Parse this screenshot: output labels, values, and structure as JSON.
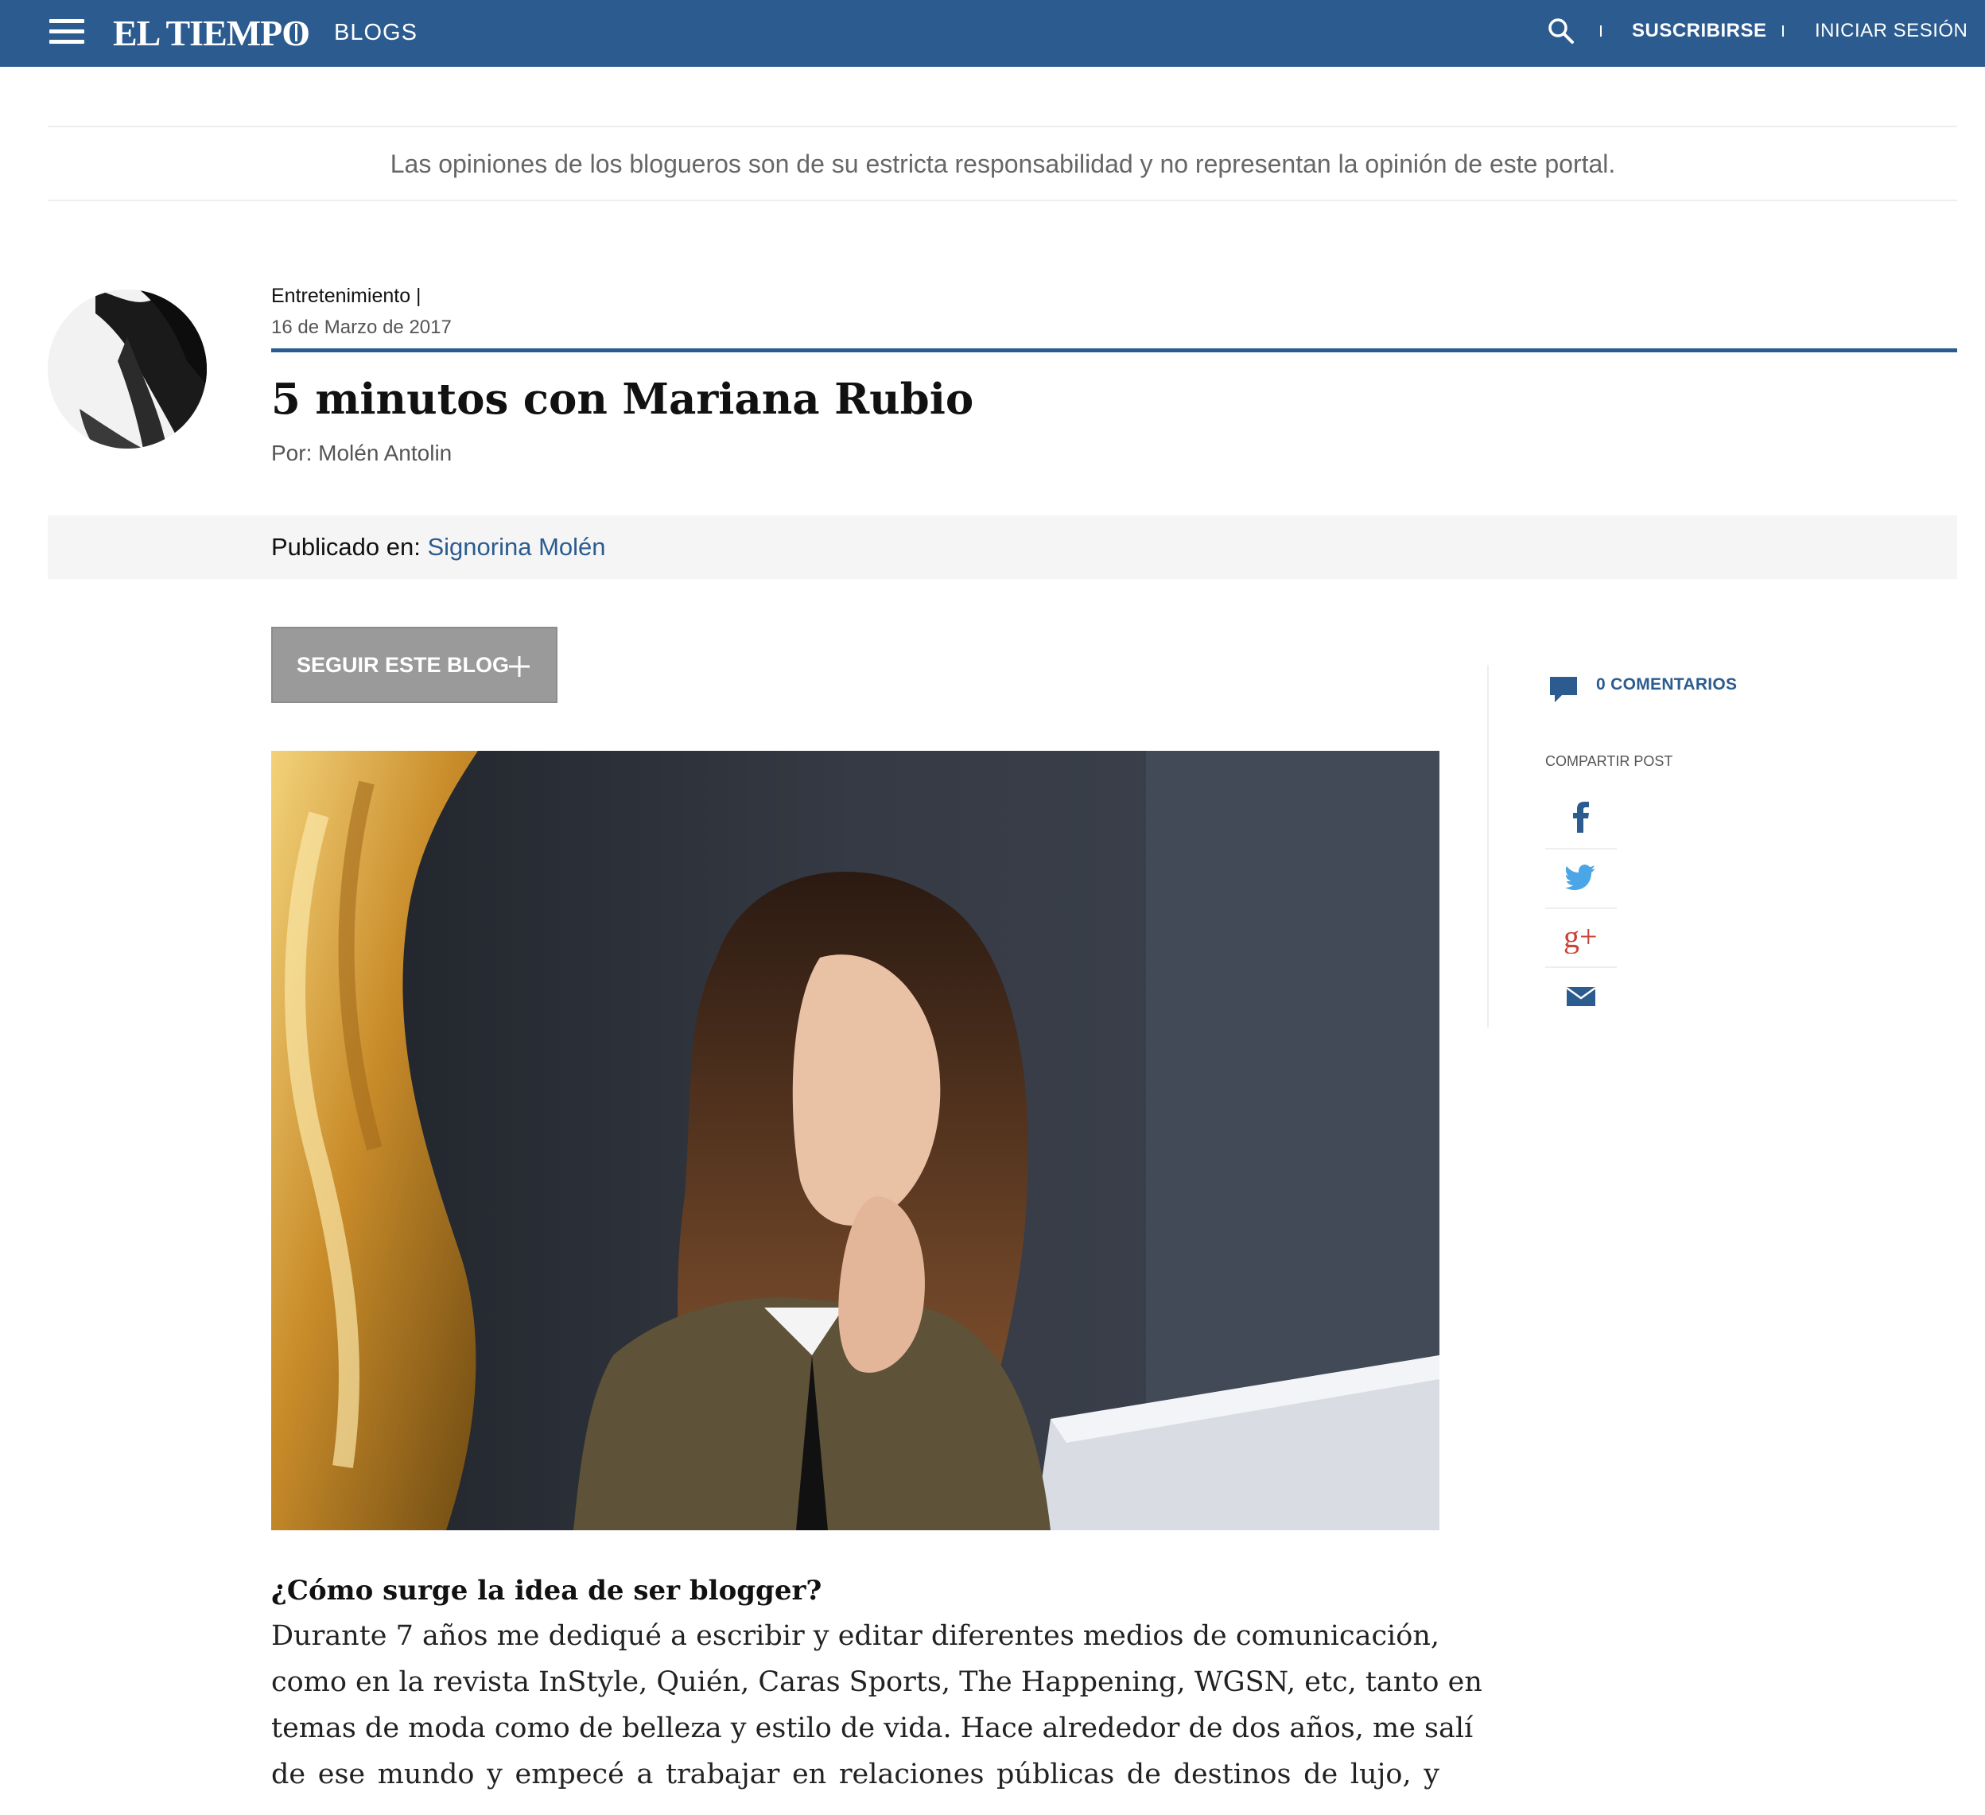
{
  "header": {
    "logo_text": "EL TIEMPO",
    "section_label": "BLOGS",
    "subscribe_label": "SUSCRIBIRSE",
    "login_label": "INICIAR SESIÓN",
    "bar_color": "#2b5b8f"
  },
  "disclaimer": "Las opiniones de los blogueros son de su estricta responsabilidad y no representan la opinión de este portal.",
  "post": {
    "category": "Entretenimiento |",
    "date": "16 de Marzo de 2017",
    "title": "5 minutos con Mariana Rubio",
    "byline": "Por: Molén Antolin",
    "published_prefix": "Publicado en: ",
    "blog_name": "Signorina Molén",
    "follow_label": "SEGUIR ESTE BLOG"
  },
  "sidebar": {
    "comments_label": "0 COMENTARIOS",
    "share_label": "COMPARTIR POST",
    "share_icons": [
      "facebook-icon",
      "twitter-icon",
      "google-plus-icon",
      "email-icon"
    ]
  },
  "article": {
    "question": "¿Cómo surge la idea de ser blogger?",
    "lines": [
      "Durante 7 años me dediqué a escribir y editar diferentes medios de comunicación,",
      "como en la revista InStyle, Quién, Caras Sports, The Happening, WGSN, etc, tanto en",
      "temas de moda como de belleza y estilo de vida. Hace alrededor de dos años, me salí",
      "de ese mundo y empecé a trabajar en relaciones públicas de destinos de lujo, y"
    ]
  }
}
